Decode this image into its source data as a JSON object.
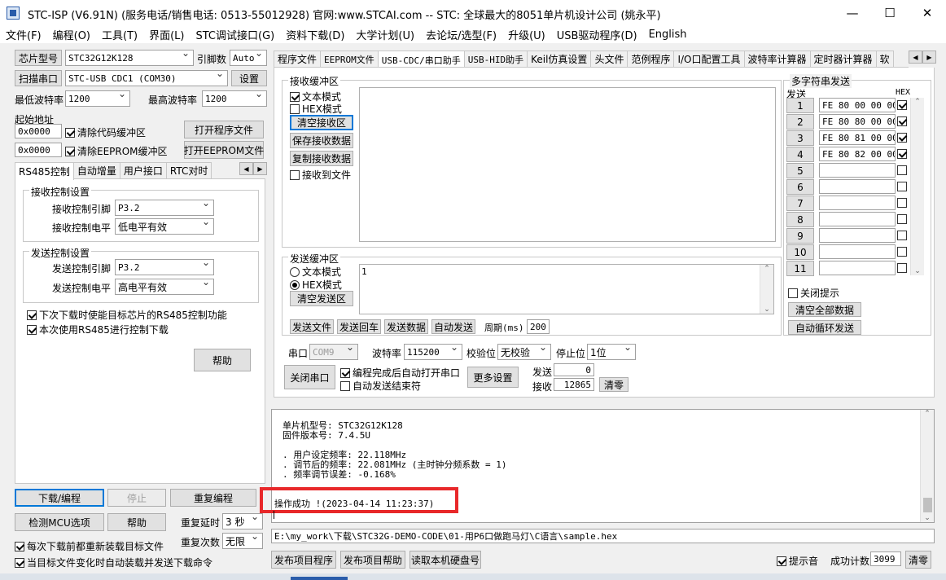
{
  "window": {
    "title": "STC-ISP (V6.91N) (服务电话/销售电话: 0513-55012928) 官网:www.STCAI.com  -- STC: 全球最大的8051单片机设计公司 (姚永平)",
    "minimize": "—",
    "maximize": "☐",
    "close": "✕"
  },
  "menu": [
    "文件(F)",
    "编程(O)",
    "工具(T)",
    "界面(L)",
    "STC调试接口(G)",
    "资料下载(D)",
    "大学计划(U)",
    "去论坛/选型(F)",
    "升级(U)",
    "USB驱动程序(D)",
    "English"
  ],
  "left": {
    "chip_button": "芯片型号",
    "chip_value": "STC32G12K128",
    "pins_label": "引脚数",
    "pins_value": "Auto",
    "scan_button": "扫描串口",
    "port_value": "STC-USB CDC1 (COM30)",
    "settings_button": "设置",
    "min_baud_label": "最低波特率",
    "min_baud_value": "1200",
    "max_baud_label": "最高波特率",
    "max_baud_value": "1200",
    "start_addr_label": "起始地址",
    "code_addr": "0x0000",
    "clear_code_check": "清除代码缓冲区",
    "open_prog_button": "打开程序文件",
    "eeprom_addr": "0x0000",
    "clear_eeprom_check": "清除EEPROM缓冲区",
    "open_eeprom_button": "打开EEPROM文件",
    "tabs": [
      "RS485控制",
      "自动增量",
      "用户接口",
      "RTC对时"
    ],
    "rx_group": "接收控制设置",
    "rx_pin_label": "接收控制引脚",
    "rx_pin_value": "P3.2",
    "rx_level_label": "接收控制电平",
    "rx_level_value": "低电平有效",
    "tx_group": "发送控制设置",
    "tx_pin_label": "发送控制引脚",
    "tx_pin_value": "P3.2",
    "tx_level_label": "发送控制电平",
    "tx_level_value": "高电平有效",
    "rs485_next_check": "下次下载时使能目标芯片的RS485控制功能",
    "rs485_this_check": "本次使用RS485进行控制下载",
    "help_button": "帮助",
    "download_button": "下载/编程",
    "stop_button": "停止",
    "reprogram_button": "重复编程",
    "detect_button": "检测MCU选项",
    "help2_button": "帮助",
    "repeat_delay_label": "重复延时",
    "repeat_delay_value": "3 秒",
    "repeat_count_label": "重复次数",
    "repeat_count_value": "无限",
    "reload_check": "每次下载前都重新装载目标文件",
    "autosend_check": "当目标文件变化时自动装载并发送下载命令"
  },
  "right_tabs": [
    "程序文件",
    "EEPROM文件",
    "USB-CDC/串口助手",
    "USB-HID助手",
    "Keil仿真设置",
    "头文件",
    "范例程序",
    "I/O口配置工具",
    "波特率计算器",
    "定时器计算器",
    "软"
  ],
  "serial": {
    "rx_group": "接收缓冲区",
    "rx_text_mode": "文本模式",
    "rx_hex_mode": "HEX模式",
    "clear_rx_button": "清空接收区",
    "save_rx_button": "保存接收数据",
    "copy_rx_button": "复制接收数据",
    "rx_to_file": "接收到文件",
    "tx_group": "发送缓冲区",
    "tx_text_mode": "文本模式",
    "tx_hex_mode": "HEX模式",
    "clear_tx_button": "清空发送区",
    "tx_content": "1",
    "send_file_button": "发送文件",
    "send_return_button": "发送回车",
    "send_data_button": "发送数据",
    "auto_send_button": "自动发送",
    "period_label": "周期(ms)",
    "period_value": "200",
    "port_label": "串口",
    "port_value": "COM9",
    "baud_label": "波特率",
    "baud_value": "115200",
    "parity_label": "校验位",
    "parity_value": "无校验",
    "stop_label": "停止位",
    "stop_value": "1位",
    "close_port_button": "关闭串口",
    "auto_open_check": "编程完成后自动打开串口",
    "auto_end_check": "自动发送结束符",
    "more_button": "更多设置",
    "send_label": "发送",
    "send_count": "0",
    "recv_label": "接收",
    "recv_count": "12865",
    "clear_button": "清零"
  },
  "multi": {
    "group": "多字符串发送",
    "send_header": "发送",
    "hex_header": "HEX",
    "rows": [
      {
        "n": "1",
        "v": "FE 80 00 00 00",
        "hex": true
      },
      {
        "n": "2",
        "v": "FE 80 80 00 00",
        "hex": true
      },
      {
        "n": "3",
        "v": "FE 80 81 00 00",
        "hex": true
      },
      {
        "n": "4",
        "v": "FE 80 82 00 00",
        "hex": true
      },
      {
        "n": "5",
        "v": "",
        "hex": false
      },
      {
        "n": "6",
        "v": "",
        "hex": false
      },
      {
        "n": "7",
        "v": "",
        "hex": false
      },
      {
        "n": "8",
        "v": "",
        "hex": false
      },
      {
        "n": "9",
        "v": "",
        "hex": false
      },
      {
        "n": "10",
        "v": "",
        "hex": false
      },
      {
        "n": "11",
        "v": "",
        "hex": false
      }
    ],
    "close_tip": "关闭提示",
    "clear_all_button": "清空全部数据",
    "auto_loop_button": "自动循环发送"
  },
  "output": {
    "lines": [
      "单片机型号: STC32G12K128",
      "固件版本号: 7.4.5U",
      "",
      ". 用户设定频率: 22.118MHz",
      ". 调节后的频率: 22.081MHz (主时钟分频系数 = 1)",
      ". 频率调节误差: -0.168%"
    ],
    "success": "操作成功 !(2023-04-14 11:23:37)",
    "highlight_color": "#e8282a"
  },
  "status": {
    "path": "E:\\my_work\\下载\\STC32G-DEMO-CODE\\01-用P6口做跑马灯\\C语言\\sample.hex",
    "publish_button": "发布项目程序",
    "publish_help_button": "发布项目帮助",
    "read_disk_button": "读取本机硬盘号",
    "sound_check": "提示音",
    "success_count_label": "成功计数",
    "success_count": "3099",
    "clear_button": "清零"
  }
}
